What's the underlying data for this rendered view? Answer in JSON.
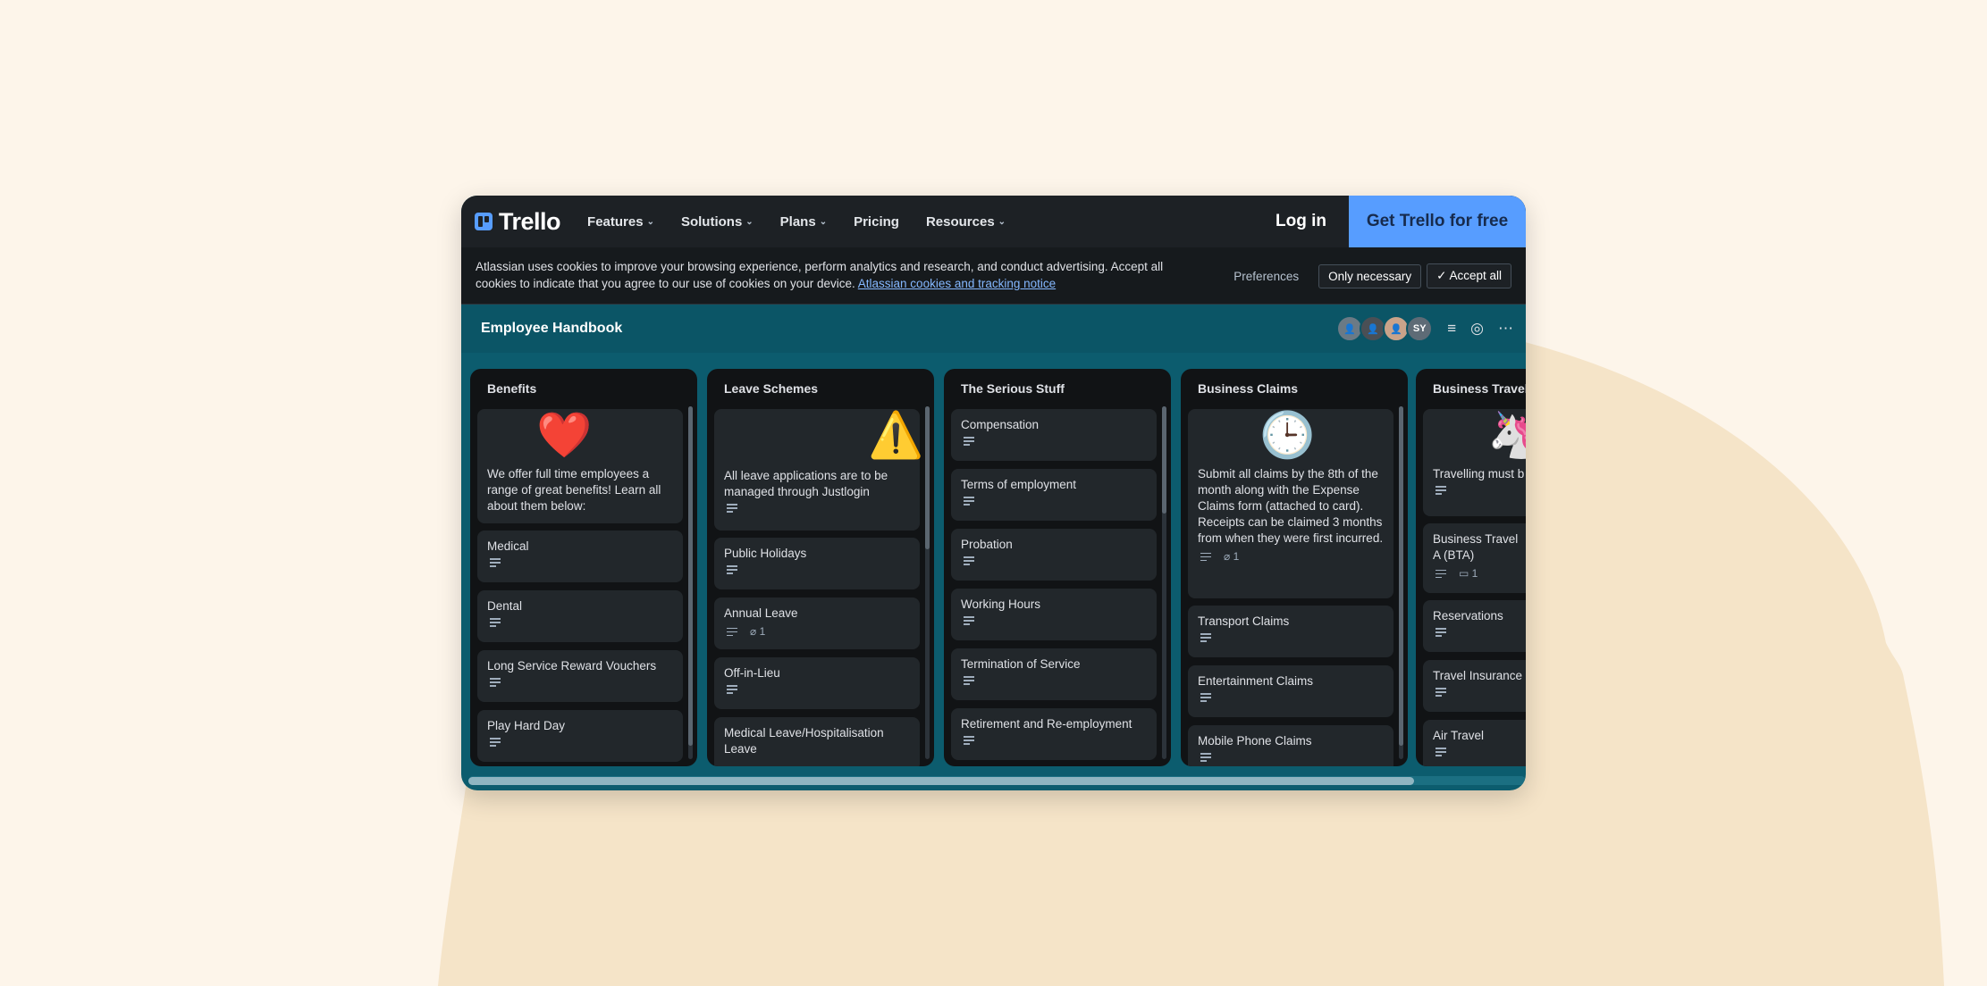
{
  "nav": {
    "logo": "Trello",
    "items": [
      "Features",
      "Solutions",
      "Plans",
      "Pricing",
      "Resources"
    ],
    "login": "Log in",
    "cta": "Get Trello for free"
  },
  "cookie": {
    "text": "Atlassian uses cookies to improve your browsing experience, perform analytics and research, and conduct advertising. Accept all cookies to indicate that you agree to our use of cookies on your device.",
    "link": "Atlassian cookies and tracking notice",
    "preferences": "Preferences",
    "only_necessary": "Only necessary",
    "accept_all": "Accept all"
  },
  "board": {
    "title": "Employee Handbook",
    "avatar_initials": "SY"
  },
  "lists": [
    {
      "title": "Benefits",
      "cards": [
        {
          "title": "We offer full time employees a range of great benefits! Learn all about them below:",
          "emoji": "❤️"
        },
        {
          "title": "Medical"
        },
        {
          "title": "Dental"
        },
        {
          "title": "Long Service Reward Vouchers"
        },
        {
          "title": "Play Hard Day"
        }
      ]
    },
    {
      "title": "Leave Schemes",
      "cards": [
        {
          "title": "All leave applications are to be managed through Justlogin",
          "emoji": "⚠️"
        },
        {
          "title": "Public Holidays"
        },
        {
          "title": "Annual Leave",
          "attachments": "1"
        },
        {
          "title": "Off-in-Lieu"
        },
        {
          "title": "Medical Leave/Hospitalisation Leave"
        }
      ]
    },
    {
      "title": "The Serious Stuff",
      "cards": [
        {
          "title": "Compensation"
        },
        {
          "title": "Terms of employment"
        },
        {
          "title": "Probation"
        },
        {
          "title": "Working Hours"
        },
        {
          "title": "Termination of Service"
        },
        {
          "title": "Retirement and Re-employment"
        }
      ]
    },
    {
      "title": "Business Claims",
      "cards": [
        {
          "title": "Submit all claims by the 8th of the month along with the Expense Claims form (attached to card). Receipts can be claimed 3 months from when they were first incurred.",
          "emoji": "🕒",
          "attachments": "1"
        },
        {
          "title": "Transport Claims"
        },
        {
          "title": "Entertainment Claims"
        },
        {
          "title": "Mobile Phone Claims"
        }
      ]
    },
    {
      "title": "Business Travel",
      "cards": [
        {
          "title": "Travelling must b",
          "emoji": "🦄"
        },
        {
          "title": "Business Travel A (BTA)",
          "comments": "1"
        },
        {
          "title": "Reservations"
        },
        {
          "title": "Travel Insurance"
        },
        {
          "title": "Air Travel"
        }
      ]
    }
  ]
}
